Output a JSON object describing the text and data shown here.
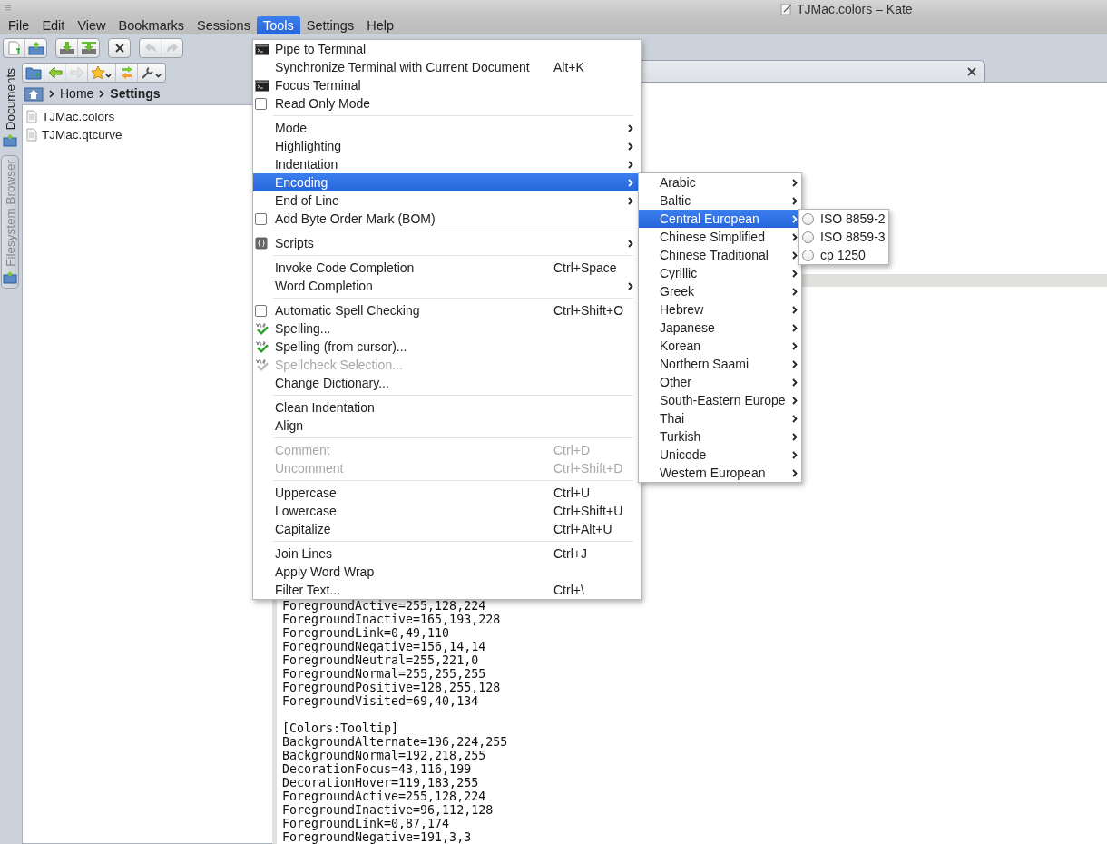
{
  "window": {
    "title": "TJMac.colors – Kate",
    "handle": "≡"
  },
  "menubar": [
    {
      "label": "File",
      "selected": false
    },
    {
      "label": "Edit",
      "selected": false
    },
    {
      "label": "View",
      "selected": false
    },
    {
      "label": "Bookmarks",
      "selected": false
    },
    {
      "label": "Sessions",
      "selected": false
    },
    {
      "label": "Tools",
      "selected": true
    },
    {
      "label": "Settings",
      "selected": false
    },
    {
      "label": "Help",
      "selected": false
    }
  ],
  "main_toolbar": [
    [
      {
        "kind": "new",
        "disabled": false
      },
      {
        "kind": "open",
        "disabled": false
      }
    ],
    [
      {
        "kind": "save",
        "disabled": false
      },
      {
        "kind": "save-all",
        "disabled": false
      }
    ],
    [
      {
        "kind": "close",
        "disabled": false
      }
    ],
    [
      {
        "kind": "undo",
        "disabled": true
      },
      {
        "kind": "redo",
        "disabled": true
      }
    ]
  ],
  "browser_toolbar": [
    {
      "kind": "new-folder",
      "disabled": false
    },
    {
      "kind": "back",
      "disabled": false
    },
    {
      "kind": "forward",
      "disabled": true
    },
    {
      "kind": "bookmarks",
      "disabled": false
    },
    {
      "kind": "sync",
      "disabled": false
    },
    {
      "kind": "options",
      "disabled": false
    }
  ],
  "side_tabs": [
    {
      "label": "Documents",
      "selected": true
    },
    {
      "label": "Filesystem Browser",
      "selected": false
    }
  ],
  "breadcrumb": [
    "Home",
    "Settings"
  ],
  "files": [
    {
      "name": "TJMac.colors"
    },
    {
      "name": "TJMac.qtcurve"
    }
  ],
  "tools_menu": {
    "sections": [
      [
        {
          "kind": "terminal",
          "label": "Pipe to Terminal"
        },
        {
          "kind": "plain",
          "label": "Synchronize Terminal with Current Document",
          "shortcut": "Alt+K"
        },
        {
          "kind": "terminal",
          "label": "Focus Terminal"
        },
        {
          "kind": "check",
          "label": "Read Only Mode",
          "checked": false
        }
      ],
      [
        {
          "kind": "plain",
          "label": "Mode",
          "submenu": true,
          "selected": false
        },
        {
          "kind": "plain",
          "label": "Highlighting",
          "submenu": true,
          "selected": false
        },
        {
          "kind": "plain",
          "label": "Indentation",
          "submenu": true,
          "selected": false
        },
        {
          "kind": "plain",
          "label": "Encoding",
          "submenu": true,
          "selected": true
        },
        {
          "kind": "plain",
          "label": "End of Line",
          "submenu": true,
          "selected": false
        },
        {
          "kind": "check",
          "label": "Add Byte Order Mark (BOM)",
          "checked": false
        }
      ],
      [
        {
          "kind": "script",
          "label": "Scripts",
          "submenu": true,
          "selected": false
        }
      ],
      [
        {
          "kind": "plain",
          "label": "Invoke Code Completion",
          "shortcut": "Ctrl+Space"
        },
        {
          "kind": "plain",
          "label": "Word Completion",
          "submenu": true,
          "selected": false
        }
      ],
      [
        {
          "kind": "check",
          "label": "Automatic Spell Checking",
          "shortcut": "Ctrl+Shift+O",
          "checked": false
        },
        {
          "kind": "spell",
          "label": "Spelling...",
          "disabled": false
        },
        {
          "kind": "spell",
          "label": "Spelling (from cursor)...",
          "disabled": false
        },
        {
          "kind": "spell",
          "label": "Spellcheck Selection...",
          "disabled": true
        },
        {
          "kind": "plain",
          "label": "Change Dictionary..."
        }
      ],
      [
        {
          "kind": "plain",
          "label": "Clean Indentation"
        },
        {
          "kind": "plain",
          "label": "Align"
        }
      ],
      [
        {
          "kind": "plain",
          "label": "Comment",
          "shortcut": "Ctrl+D",
          "disabled": true
        },
        {
          "kind": "plain",
          "label": "Uncomment",
          "shortcut": "Ctrl+Shift+D",
          "disabled": true
        }
      ],
      [
        {
          "kind": "plain",
          "label": "Uppercase",
          "shortcut": "Ctrl+U"
        },
        {
          "kind": "plain",
          "label": "Lowercase",
          "shortcut": "Ctrl+Shift+U"
        },
        {
          "kind": "plain",
          "label": "Capitalize",
          "shortcut": "Ctrl+Alt+U"
        }
      ],
      [
        {
          "kind": "plain",
          "label": "Join Lines",
          "shortcut": "Ctrl+J"
        },
        {
          "kind": "plain",
          "label": "Apply Word Wrap"
        },
        {
          "kind": "plain",
          "label": "Filter Text...",
          "shortcut": "Ctrl+\\"
        }
      ]
    ]
  },
  "encoding_menu": [
    {
      "label": "Arabic",
      "selected": false
    },
    {
      "label": "Baltic",
      "selected": false
    },
    {
      "label": "Central European",
      "selected": true
    },
    {
      "label": "Chinese Simplified",
      "selected": false
    },
    {
      "label": "Chinese Traditional",
      "selected": false
    },
    {
      "label": "Cyrillic",
      "selected": false
    },
    {
      "label": "Greek",
      "selected": false
    },
    {
      "label": "Hebrew",
      "selected": false
    },
    {
      "label": "Japanese",
      "selected": false
    },
    {
      "label": "Korean",
      "selected": false
    },
    {
      "label": "Northern Saami",
      "selected": false
    },
    {
      "label": "Other",
      "selected": false
    },
    {
      "label": "South-Eastern Europe",
      "selected": false
    },
    {
      "label": "Thai",
      "selected": false
    },
    {
      "label": "Turkish",
      "selected": false
    },
    {
      "label": "Unicode",
      "selected": false
    },
    {
      "label": "Western European",
      "selected": false
    }
  ],
  "central_european_menu": [
    {
      "label": "ISO 8859-2",
      "checked": false
    },
    {
      "label": "ISO 8859-3",
      "checked": false
    },
    {
      "label": "cp 1250",
      "checked": false
    }
  ],
  "editor": {
    "blocks": [
      [
        "ForegroundActive=255,128,224",
        "ForegroundInactive=165,193,228",
        "ForegroundLink=0,49,110",
        "ForegroundNegative=156,14,14",
        "ForegroundNeutral=255,221,0",
        "ForegroundNormal=255,255,255",
        "ForegroundPositive=128,255,128",
        "ForegroundVisited=69,40,134"
      ],
      [
        "[Colors:Tooltip]",
        "BackgroundAlternate=196,224,255",
        "BackgroundNormal=192,218,255",
        "DecorationFocus=43,116,199",
        "DecorationHover=119,183,255",
        "ForegroundActive=255,128,224",
        "ForegroundInactive=96,112,128",
        "ForegroundLink=0,87,174",
        "ForegroundNegative=191,3,3"
      ]
    ]
  }
}
